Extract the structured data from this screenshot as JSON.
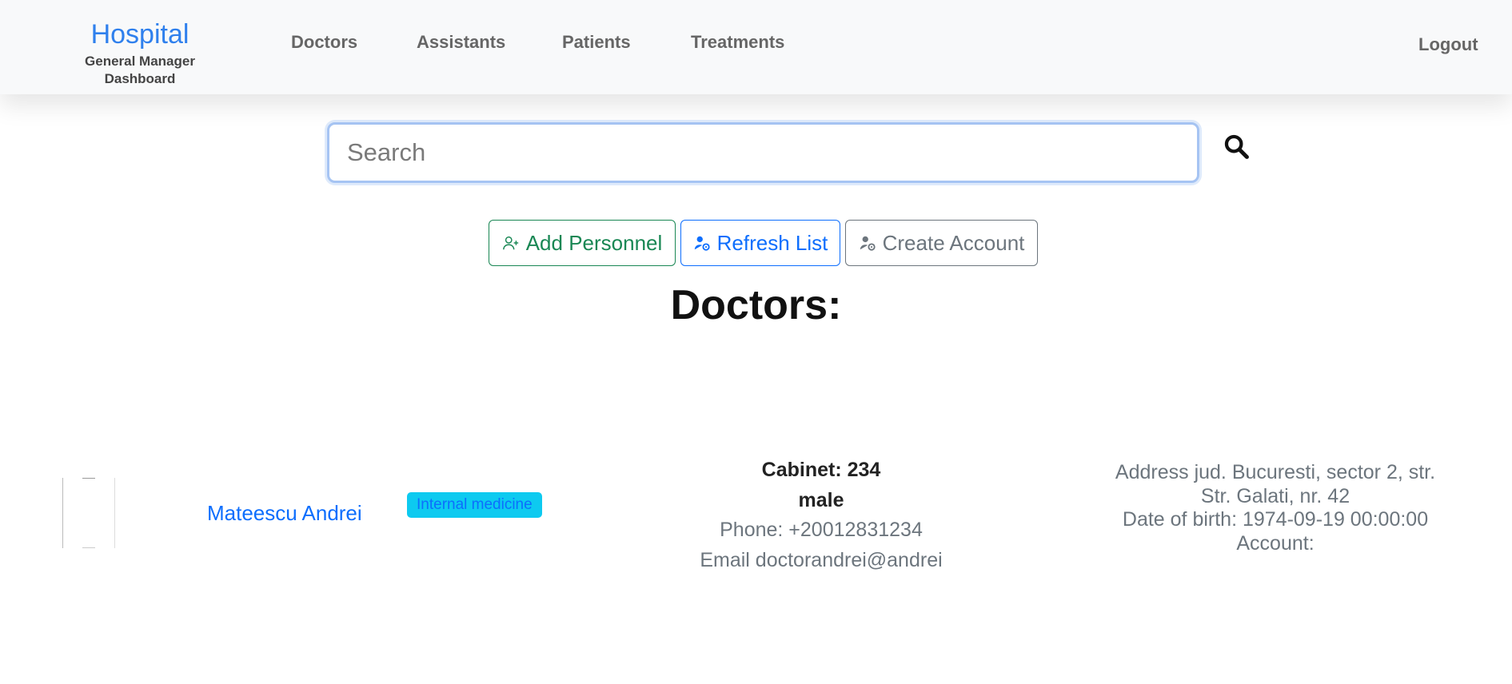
{
  "navbar": {
    "brand_title": "Hospital",
    "brand_subtitle": "General Manager Dashboard",
    "links": [
      "Doctors",
      "Assistants",
      "Patients",
      "Treatments"
    ],
    "logout": "Logout"
  },
  "search": {
    "placeholder": "Search",
    "value": ""
  },
  "actions": {
    "add_personnel": "Add Personnel",
    "refresh_list": "Refresh List",
    "create_account": "Create Account"
  },
  "section_title": "Doctors:",
  "doctors": [
    {
      "name": "Mateescu Andrei",
      "specialty": "Internal medicine",
      "cabinet": "Cabinet: 234",
      "gender": "male",
      "phone": "Phone: +20012831234",
      "email": "Email doctorandrei@andrei",
      "address_line1": "Address jud. Bucuresti, sector 2, str.",
      "address_line2": "Str. Galati, nr. 42",
      "dob": "Date of birth: 1974-09-19 00:00:00",
      "account": "Account:"
    }
  ],
  "colors": {
    "brand": "#2f80ed",
    "success": "#198754",
    "primary": "#0d6efd",
    "secondary": "#6c757d",
    "badge_bg": "#0dcaf0"
  },
  "icons": {
    "search": "search-icon",
    "add_personnel": "person-plus-icon",
    "refresh_list": "person-gear-icon",
    "create_account": "person-gear-icon"
  }
}
